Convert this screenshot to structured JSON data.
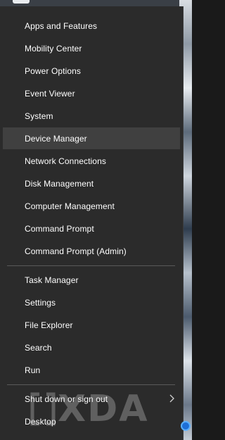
{
  "menu": {
    "group1": [
      {
        "label": "Apps and Features"
      },
      {
        "label": "Mobility Center"
      },
      {
        "label": "Power Options"
      },
      {
        "label": "Event Viewer"
      },
      {
        "label": "System"
      },
      {
        "label": "Device Manager",
        "highlighted": true
      },
      {
        "label": "Network Connections"
      },
      {
        "label": "Disk Management"
      },
      {
        "label": "Computer Management"
      },
      {
        "label": "Command Prompt"
      },
      {
        "label": "Command Prompt (Admin)"
      }
    ],
    "group2": [
      {
        "label": "Task Manager"
      },
      {
        "label": "Settings"
      },
      {
        "label": "File Explorer"
      },
      {
        "label": "Search"
      },
      {
        "label": "Run"
      }
    ],
    "group3": [
      {
        "label": "Shut down or sign out",
        "submenu_icon": "chevron-right-icon"
      },
      {
        "label": "Desktop"
      }
    ]
  },
  "watermark": {
    "text": "XDA"
  },
  "colors": {
    "menu_background": "#2b2b2b",
    "highlight": "#404040",
    "text": "#ffffff",
    "separator": "#5a5a5a"
  }
}
